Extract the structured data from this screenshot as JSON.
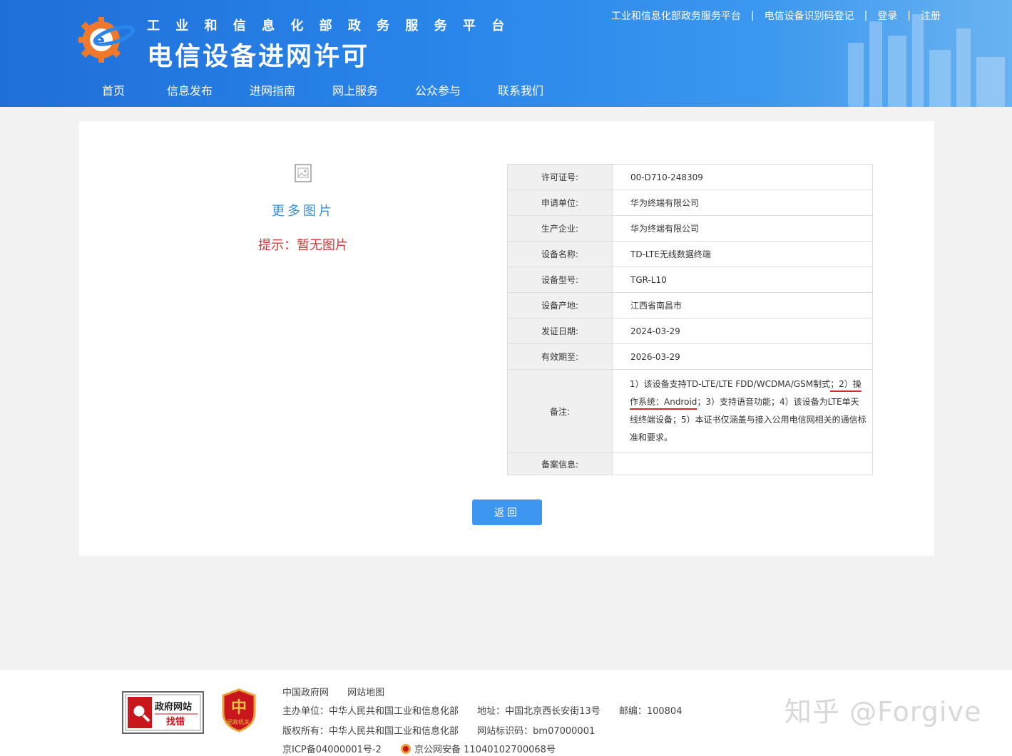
{
  "header": {
    "subtitle": "工 业 和 信 息 化 部 政 务 服 务 平 台",
    "title": "电信设备进网许可",
    "top_links": [
      "工业和信息化部政务服务平台",
      "电信设备识别码登记",
      "登录",
      "注册"
    ],
    "separator": "|",
    "nav": [
      "首页",
      "信息发布",
      "进网指南",
      "网上服务",
      "公众参与",
      "联系我们"
    ]
  },
  "gallery": {
    "more_pictures": "更多图片",
    "no_picture_hint": "提示：暂无图片"
  },
  "details": [
    {
      "label": "许可证号:",
      "value": "00-D710-248309"
    },
    {
      "label": "申请单位:",
      "value": "华为终端有限公司"
    },
    {
      "label": "生产企业:",
      "value": "华为终端有限公司"
    },
    {
      "label": "设备名称:",
      "value": "TD-LTE无线数据终端"
    },
    {
      "label": "设备型号:",
      "value": "TGR-L10"
    },
    {
      "label": "设备产地:",
      "value": "江西省南昌市"
    },
    {
      "label": "发证日期:",
      "value": "2024-03-29"
    },
    {
      "label": "有效期至:",
      "value": "2026-03-29"
    }
  ],
  "remarks": {
    "label": "备注:",
    "part1": "1）该设备支持TD-LTE/LTE FDD/WCDMA/GSM制式",
    "part2_highlighted": "；2）操作系统：Android",
    "part3": "；3）支持语音功能；4）该设备为LTE单天线终端设备；5）本证书仅涵盖与接入公用电信网相关的通信标准和要求。"
  },
  "filing": {
    "label": "备案信息:",
    "value": ""
  },
  "back_button": "返回",
  "footer": {
    "badge_find_line1": "政府网站",
    "badge_find_line2": "找错",
    "badge_party": "党政机关",
    "links": [
      "中国政府网",
      "网站地图"
    ],
    "host": "主办单位：中华人民共和国工业和信息化部",
    "address": "地址：中国北京西长安街13号",
    "postcode": "邮编：100804",
    "copyright": "版权所有：中华人民共和国工业和信息化部",
    "site_id": "网站标识码：bm07000001",
    "icp": "京ICP备04000001号-2",
    "police": "京公网安备 11040102700068号"
  },
  "watermark": "知乎 @Forgive"
}
